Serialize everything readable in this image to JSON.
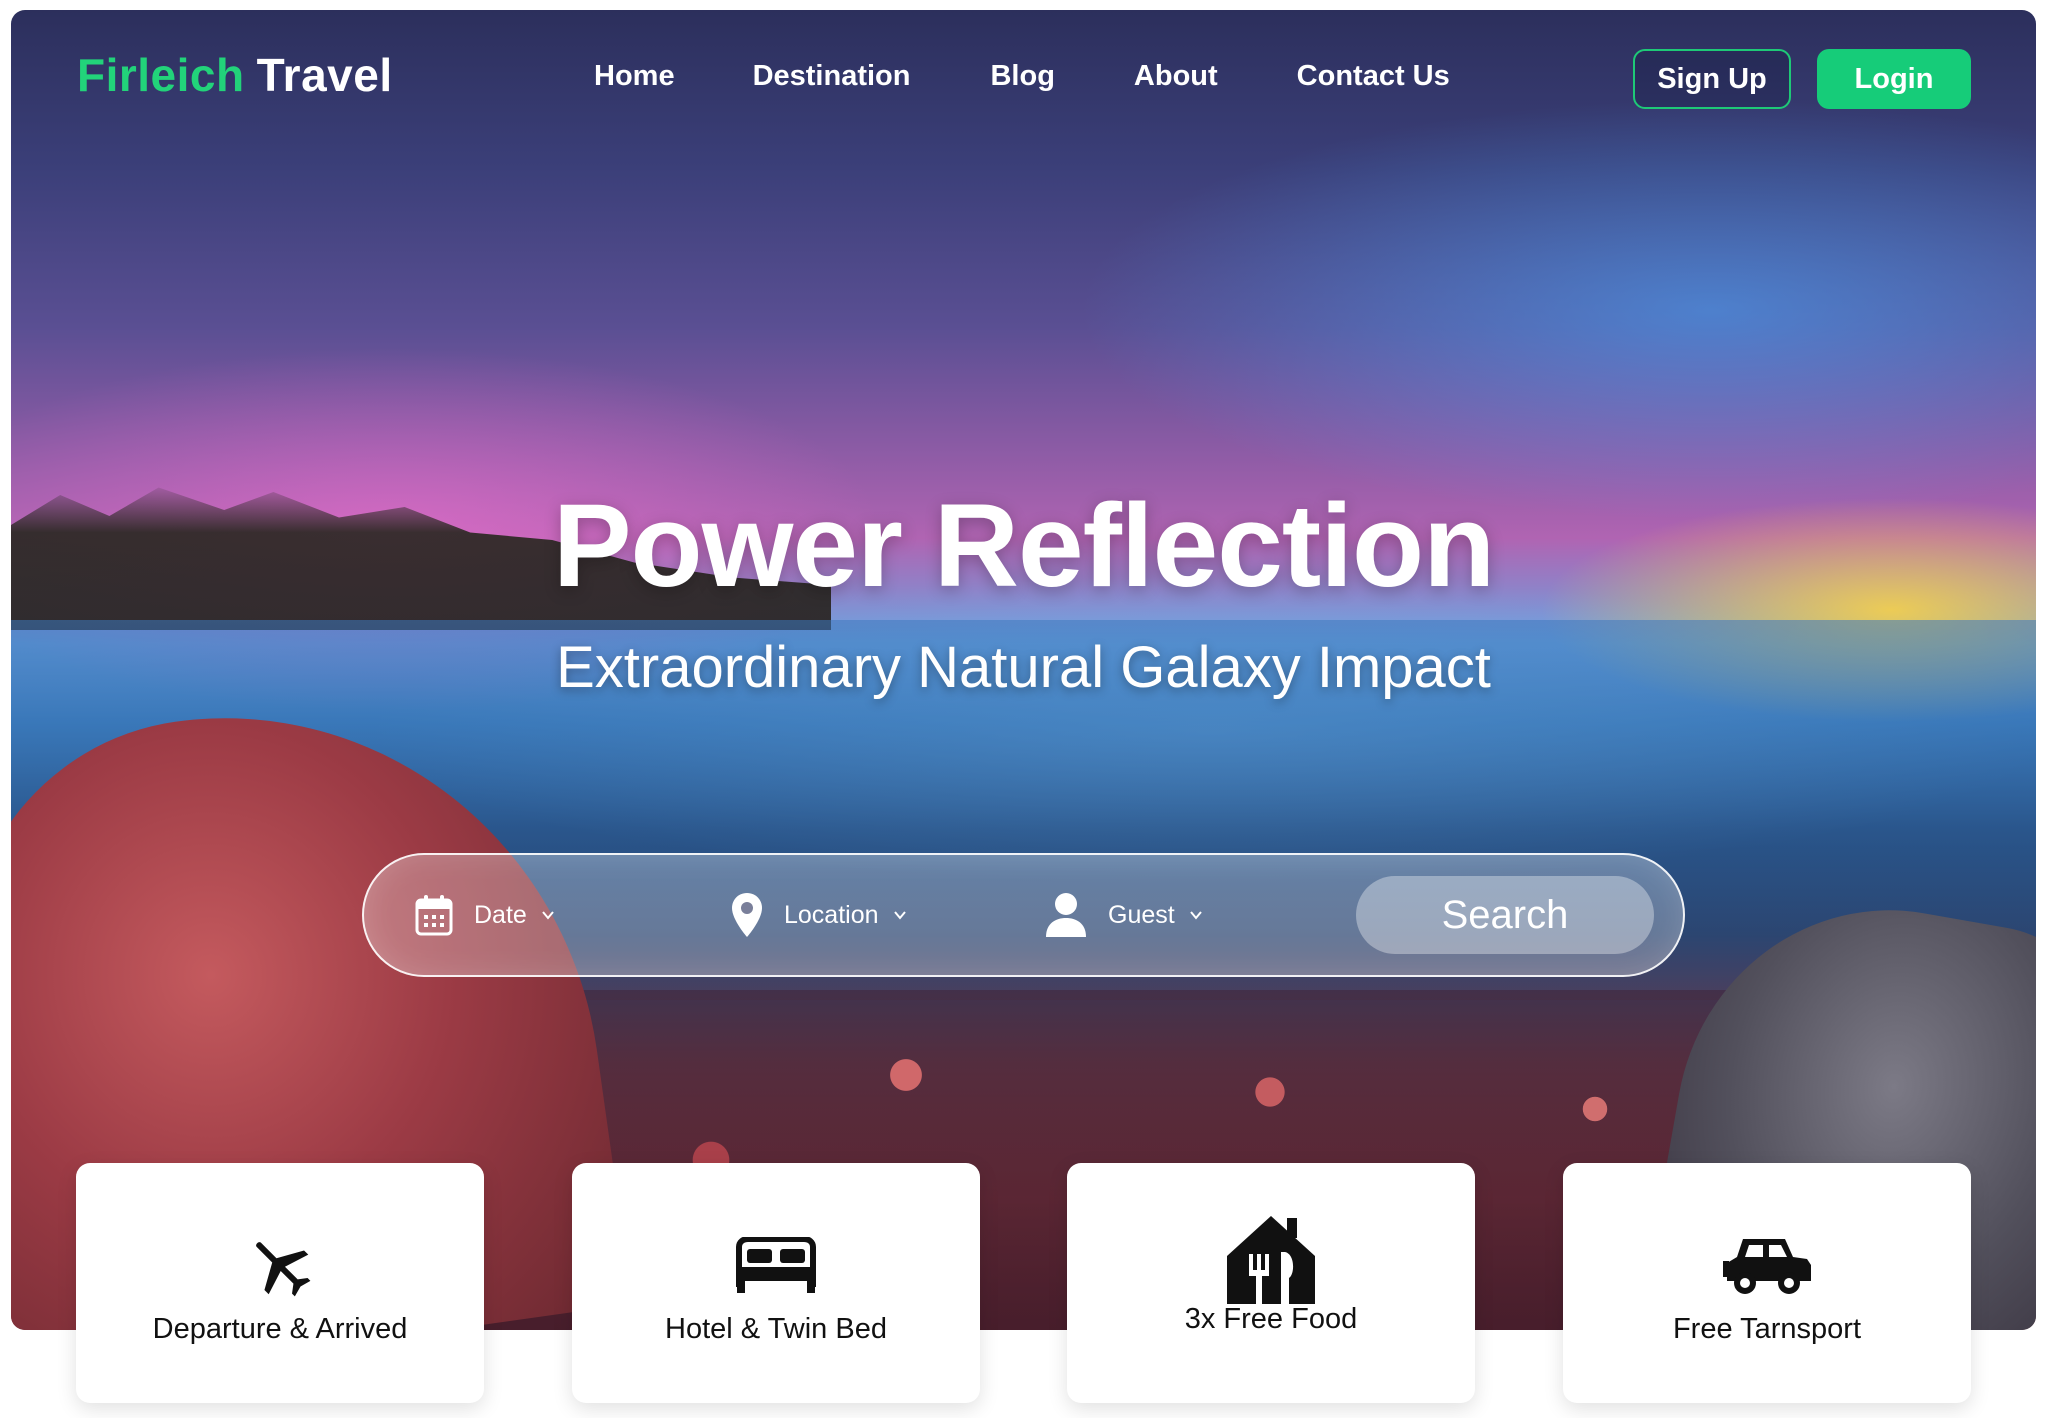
{
  "brand": {
    "name": "Firleich",
    "suffix": "Travel",
    "colors": {
      "accent": "#16cc79",
      "text": "#ffffff"
    }
  },
  "nav": {
    "items": [
      "Home",
      "Destination",
      "Blog",
      "About",
      "Contact Us"
    ]
  },
  "auth": {
    "signup_label": "Sign Up",
    "login_label": "Login"
  },
  "hero": {
    "title": "Power Reflection",
    "subtitle": "Extraordinary Natural Galaxy Impact"
  },
  "search": {
    "date_label": "Date",
    "location_label": "Location",
    "guest_label": "Guest",
    "button_label": "Search",
    "icons": [
      "calendar-icon",
      "location-pin-icon",
      "user-icon",
      "chevron-down-icon"
    ]
  },
  "features": [
    {
      "label": "Departure & Arrived",
      "icon": "airplane-icon"
    },
    {
      "label": "Hotel & Twin Bed",
      "icon": "bed-icon"
    },
    {
      "label": "3x Free Food",
      "icon": "food-house-icon"
    },
    {
      "label": "Free Tarnsport",
      "icon": "jeep-icon"
    }
  ]
}
